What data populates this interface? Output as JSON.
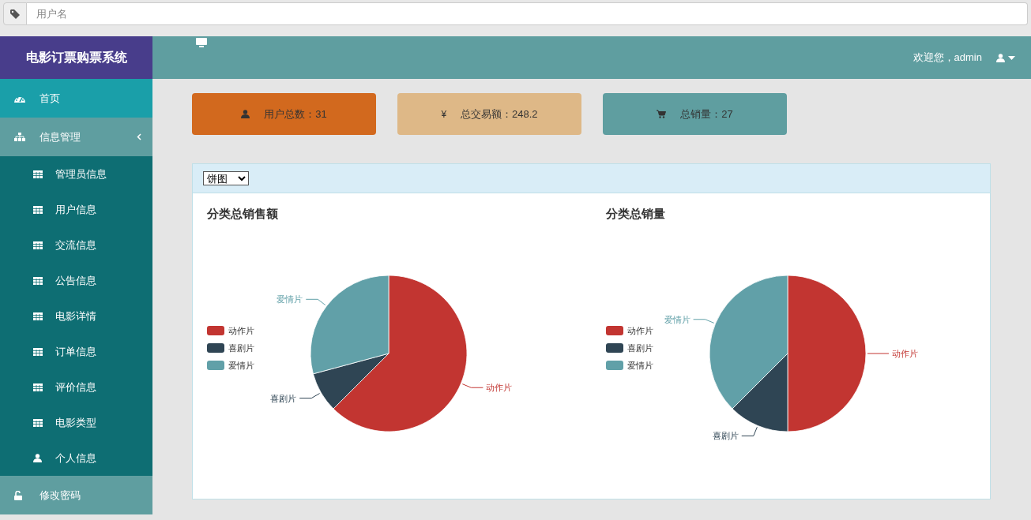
{
  "search": {
    "placeholder": "用户名"
  },
  "sidebar": {
    "title": "电影订票购票系统",
    "items": [
      {
        "label": "首页",
        "kind": "home",
        "selected": true
      },
      {
        "label": "信息管理",
        "kind": "group",
        "selected": false,
        "expanded": true,
        "children": [
          {
            "label": "管理员信息",
            "kind": "table"
          },
          {
            "label": "用户信息",
            "kind": "table"
          },
          {
            "label": "交流信息",
            "kind": "table"
          },
          {
            "label": "公告信息",
            "kind": "table"
          },
          {
            "label": "电影详情",
            "kind": "table"
          },
          {
            "label": "订单信息",
            "kind": "table"
          },
          {
            "label": "评价信息",
            "kind": "table"
          },
          {
            "label": "电影类型",
            "kind": "table"
          },
          {
            "label": "个人信息",
            "kind": "user"
          }
        ]
      },
      {
        "label": "修改密码",
        "kind": "password",
        "selected": false
      }
    ]
  },
  "header": {
    "welcome": "欢迎您，admin"
  },
  "stats": [
    {
      "kind": "user",
      "label": "用户总数：31",
      "color": "#d2691e"
    },
    {
      "kind": "symbol",
      "symbol": "¥",
      "label": "总交易额：248.2",
      "color": "#deb887"
    },
    {
      "kind": "cart",
      "label": "总销量：27",
      "color": "#5f9ea0"
    }
  ],
  "chart_panel": {
    "chart_type_select": "饼图",
    "charts": [
      {
        "chart_data": {
          "type": "pie",
          "title": "分类总销售额",
          "legend": "left",
          "categories": [
            "动作片",
            "喜剧片",
            "爱情片"
          ],
          "series": [
            {
              "values": [
                62.5,
                8.3,
                29.2
              ]
            }
          ]
        }
      },
      {
        "chart_data": {
          "type": "pie",
          "title": "分类总销量",
          "legend": "left",
          "categories": [
            "动作片",
            "喜剧片",
            "爱情片"
          ],
          "series": [
            {
              "values": [
                50,
                12.5,
                37.5
              ]
            }
          ]
        }
      }
    ]
  }
}
